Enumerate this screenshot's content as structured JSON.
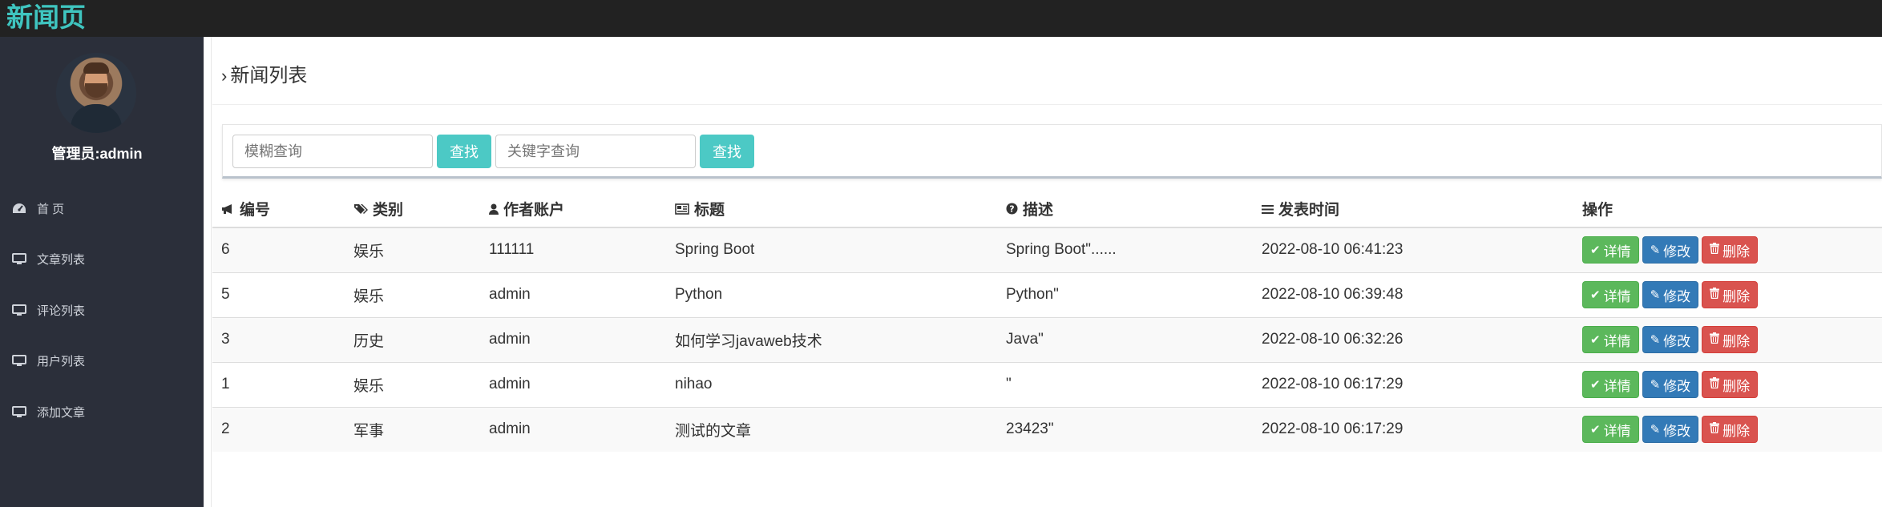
{
  "brand": "新闻页",
  "sidebar": {
    "admin_label": "管理员:admin",
    "items": [
      {
        "label": "首 页",
        "icon": "dashboard-icon"
      },
      {
        "label": "文章列表",
        "icon": "monitor-icon"
      },
      {
        "label": "评论列表",
        "icon": "monitor-icon"
      },
      {
        "label": "用户列表",
        "icon": "monitor-icon"
      },
      {
        "label": "添加文章",
        "icon": "monitor-icon"
      }
    ]
  },
  "page_title": "新闻列表",
  "search": {
    "fuzzy_placeholder": "模糊查询",
    "keyword_placeholder": "关键字查询",
    "button_label": "查找"
  },
  "table": {
    "headers": [
      "编号",
      "类别",
      "作者账户",
      "标题",
      "描述",
      "发表时间",
      "操作"
    ],
    "rows": [
      {
        "id": "6",
        "category": "娱乐",
        "author": "111111",
        "title": "Spring Boot",
        "desc": "Spring Boot\"......",
        "time": "2022-08-10 06:41:23"
      },
      {
        "id": "5",
        "category": "娱乐",
        "author": "admin",
        "title": "Python",
        "desc": "Python\"",
        "time": "2022-08-10 06:39:48"
      },
      {
        "id": "3",
        "category": "历史",
        "author": "admin",
        "title": "如何学习javaweb技术",
        "desc": "Java\"",
        "time": "2022-08-10 06:32:26"
      },
      {
        "id": "1",
        "category": "娱乐",
        "author": "admin",
        "title": "nihao",
        "desc": "\"",
        "time": "2022-08-10 06:17:29"
      },
      {
        "id": "2",
        "category": "军事",
        "author": "admin",
        "title": "测试的文章",
        "desc": "23423\"",
        "time": "2022-08-10 06:17:29"
      }
    ],
    "actions": {
      "detail": "详情",
      "edit": "修改",
      "delete": "删除"
    }
  },
  "colors": {
    "brand": "#3fc5c0",
    "sidebar_bg": "#2b2f3a",
    "topbar_bg": "#222222",
    "search_button": "#4cc9c5",
    "detail": "#5cb85c",
    "edit": "#337ab7",
    "delete": "#d9534f"
  }
}
